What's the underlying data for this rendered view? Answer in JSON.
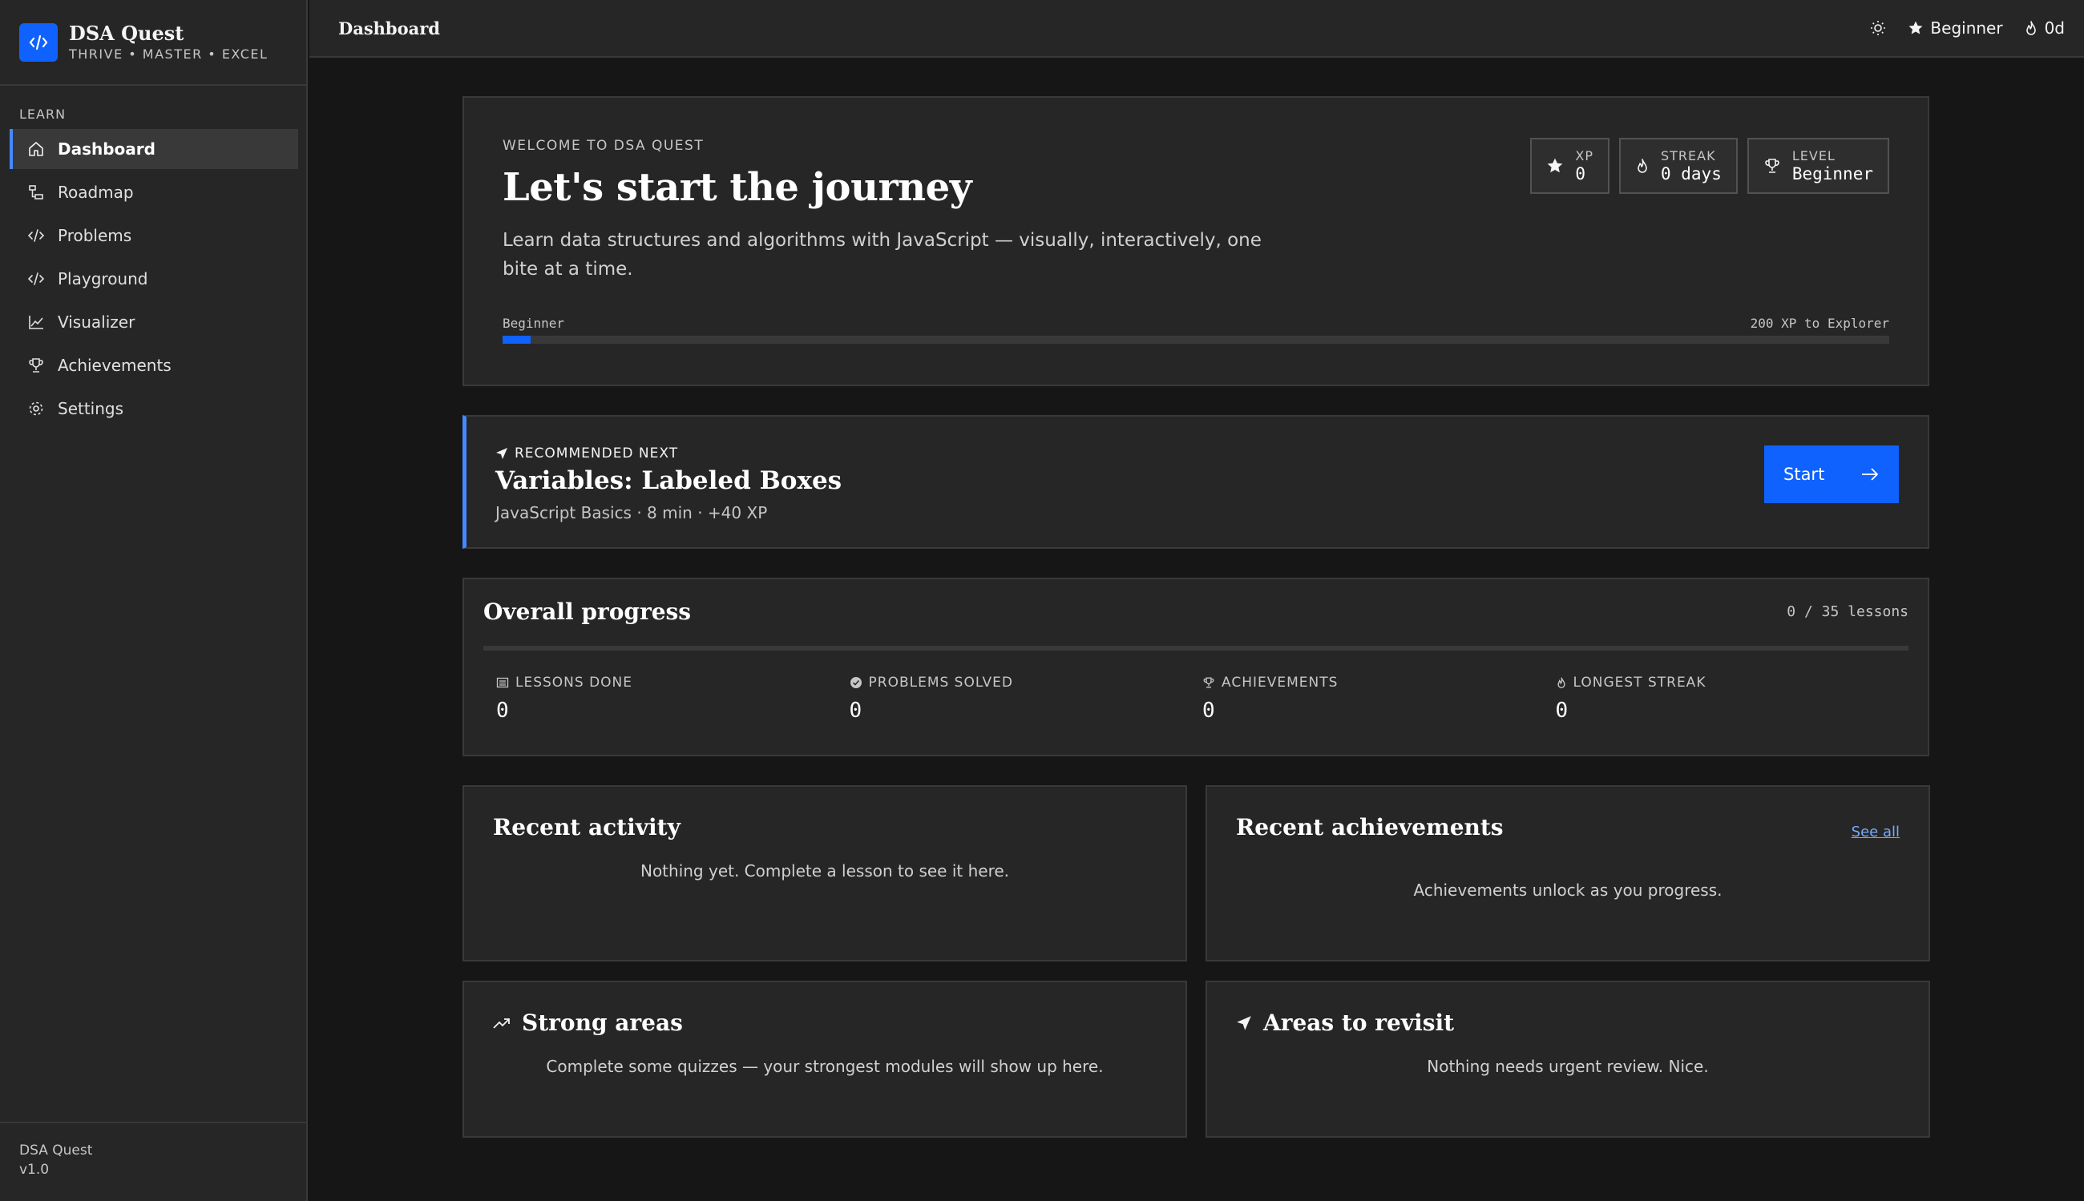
{
  "sidebar": {
    "brand": {
      "title": "DSA Quest",
      "tagline": "THRIVE • MASTER • EXCEL"
    },
    "section_label": "LEARN",
    "items": [
      {
        "label": "Dashboard",
        "icon": "home-icon",
        "active": true
      },
      {
        "label": "Roadmap",
        "icon": "roadmap-icon"
      },
      {
        "label": "Problems",
        "icon": "code-icon"
      },
      {
        "label": "Playground",
        "icon": "code-icon"
      },
      {
        "label": "Visualizer",
        "icon": "chart-line-icon"
      },
      {
        "label": "Achievements",
        "icon": "trophy-icon"
      },
      {
        "label": "Settings",
        "icon": "gear-icon"
      }
    ],
    "footer": {
      "name": "DSA Quest",
      "version": "v1.0"
    }
  },
  "topbar": {
    "title": "Dashboard",
    "level_label": "Beginner",
    "streak_label": "0d"
  },
  "hero": {
    "eyebrow": "WELCOME TO DSA QUEST",
    "title": "Let's start the journey",
    "description": "Learn data structures and algorithms with JavaScript — visually, interactively, one bite at a time.",
    "stats": {
      "xp": {
        "label": "XP",
        "value": "0"
      },
      "streak": {
        "label": "STREAK",
        "value": "0 days"
      },
      "level": {
        "label": "LEVEL",
        "value": "Beginner"
      }
    },
    "progress": {
      "left_label": "Beginner",
      "right_label": "200 XP to Explorer",
      "fraction": 0.02
    }
  },
  "recommended": {
    "eyebrow": "RECOMMENDED NEXT",
    "title": "Variables: Labeled Boxes",
    "meta": "JavaScript Basics · 8 min · +40 XP",
    "button_label": "Start"
  },
  "overall": {
    "title": "Overall progress",
    "count_label": "0 / 35 lessons",
    "fraction": 0,
    "metrics": [
      {
        "label": "LESSONS DONE",
        "value": "0",
        "icon": "list-icon"
      },
      {
        "label": "PROBLEMS SOLVED",
        "value": "0",
        "icon": "check-circle-icon"
      },
      {
        "label": "ACHIEVEMENTS",
        "value": "0",
        "icon": "trophy-icon"
      },
      {
        "label": "LONGEST STREAK",
        "value": "0",
        "icon": "flame-icon"
      }
    ]
  },
  "recent_activity": {
    "title": "Recent activity",
    "empty": "Nothing yet. Complete a lesson to see it here."
  },
  "recent_achievements": {
    "title": "Recent achievements",
    "link": "See all",
    "empty": "Achievements unlock as you progress."
  },
  "strong_areas": {
    "title": "Strong areas",
    "empty": "Complete some quizzes — your strongest modules will show up here."
  },
  "revisit_areas": {
    "title": "Areas to revisit",
    "empty": "Nothing needs urgent review. Nice."
  },
  "colors": {
    "accent": "#0f62fe",
    "accent_light": "#4589ff",
    "background": "#161616",
    "surface": "#262626",
    "border": "#393939"
  }
}
